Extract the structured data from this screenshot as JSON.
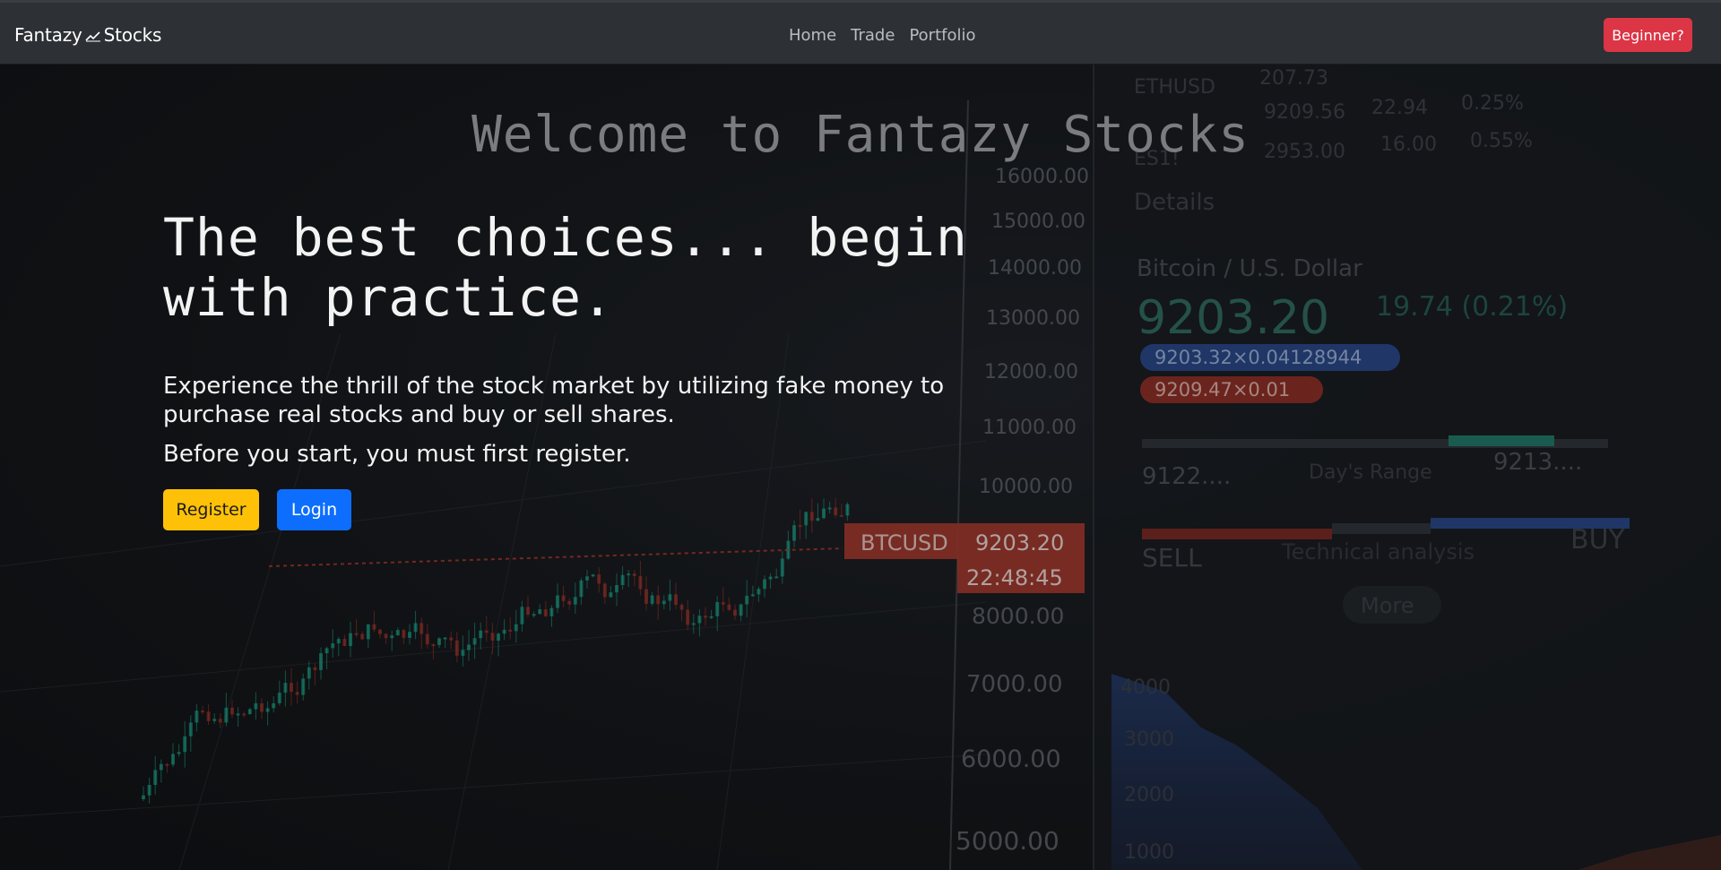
{
  "navbar": {
    "brand_left": "Fantazy",
    "brand_right": "Stocks",
    "links": [
      "Home",
      "Trade",
      "Portfolio"
    ],
    "beginner_button": "Beginner?"
  },
  "hero": {
    "welcome": "Welcome to Fantazy Stocks",
    "headline_line1": "The best choices... begin",
    "headline_line2": "with practice.",
    "description": "Experience the thrill of the stock market by utilizing fake money to purchase real stocks and buy or sell shares.",
    "note": "Before you start, you must first register.",
    "register_button": "Register",
    "login_button": "Login"
  },
  "background": {
    "axis_prices": [
      "16000.00",
      "15000.00",
      "14000.00",
      "13000.00",
      "12000.00",
      "11000.00",
      "10000.00",
      "8000.00",
      "7000.00",
      "6000.00",
      "5000.00"
    ],
    "ticker_label": "BTCUSD",
    "ticker_price": "9203.20",
    "ticker_time": "22:48:45",
    "top_rows": [
      "ETHUSD",
      "207.73",
      "9209.56",
      "22.94",
      "0.25%",
      "ES1!",
      "2953.00",
      "16.00",
      "0.55%"
    ],
    "details": "Details",
    "pair": "Bitcoin / U.S. Dollar",
    "price": "9203.20",
    "change": "19.74 (0.21%)",
    "bid": "9203.32×0.04128944",
    "ask": "9209.47×0.01",
    "range_low": "9122....",
    "range_label": "Day's Range",
    "range_high": "9213....",
    "sell": "SELL",
    "technical": "Technical analysis",
    "buy": "BUY",
    "more": "More",
    "depth_levels": [
      "4000",
      "3000",
      "2000",
      "1000"
    ],
    "accent_red": "#c0392b",
    "accent_green": "#1abc9c",
    "accent_blue": "#2b5fb5"
  }
}
